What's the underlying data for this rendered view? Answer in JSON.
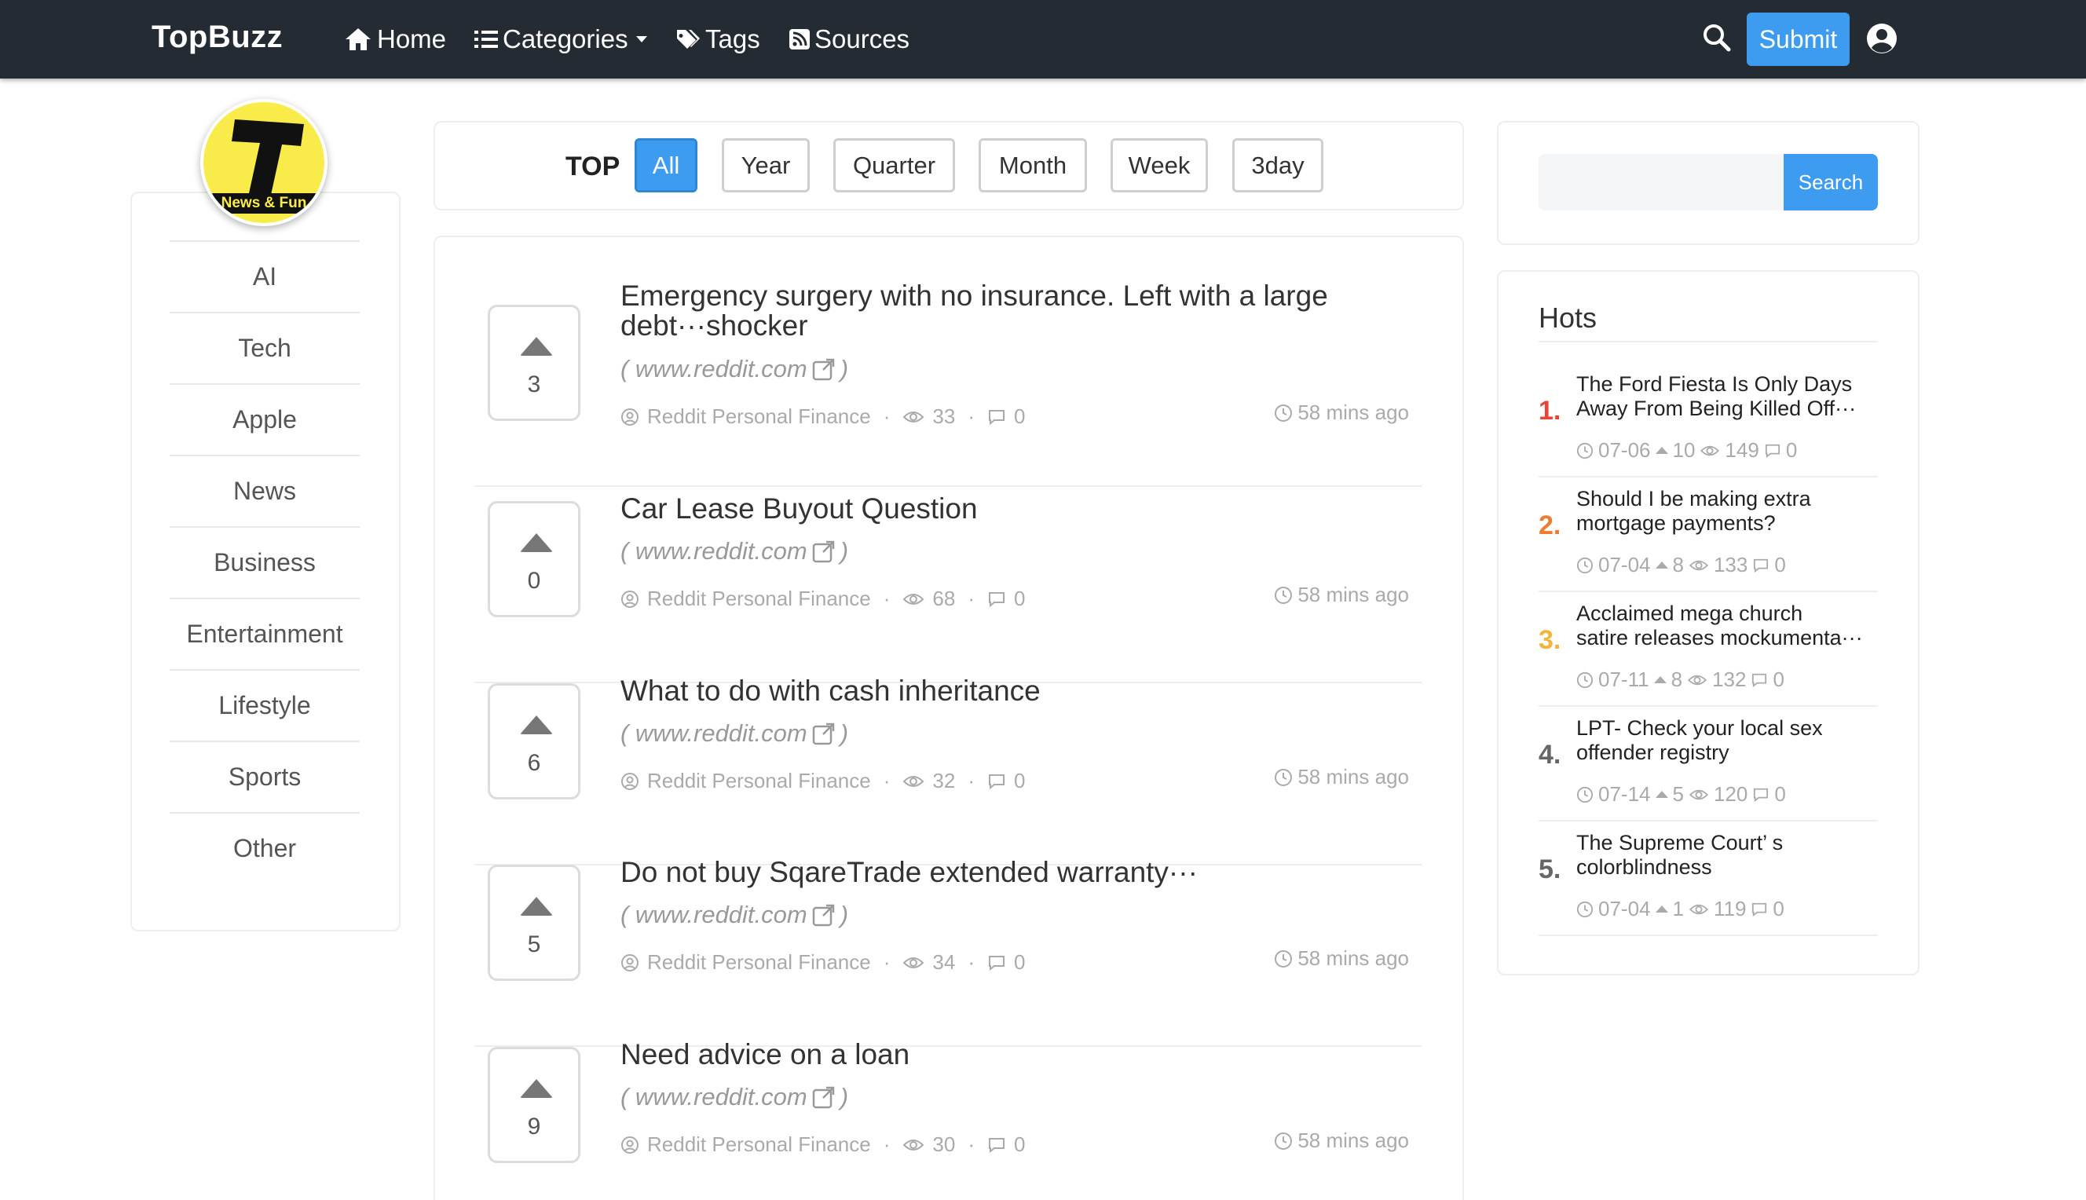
{
  "brand": "TopBuzz",
  "nav": {
    "home": "Home",
    "categories": "Categories",
    "tags": "Tags",
    "sources": "Sources",
    "submit": "Submit"
  },
  "logo": {
    "band_text": "News & Fun"
  },
  "categories": [
    "AI",
    "Tech",
    "Apple",
    "News",
    "Business",
    "Entertainment",
    "Lifestyle",
    "Sports",
    "Other"
  ],
  "filter": {
    "label": "TOP",
    "options": [
      "All",
      "Year",
      "Quarter",
      "Month",
      "Week",
      "3day"
    ],
    "active": "All"
  },
  "posts": [
    {
      "votes": "3",
      "title_l1": "Emergency surgery with no insurance. Left with a large",
      "title_l2": "debt···shocker",
      "source": "( www.reddit.com",
      "source_close": ")",
      "author": "Reddit Personal Finance",
      "views": "33",
      "comments": "0",
      "time": "58 mins ago"
    },
    {
      "votes": "0",
      "title_l1": "Car Lease Buyout Question",
      "title_l2": "",
      "source": "( www.reddit.com",
      "source_close": ")",
      "author": "Reddit Personal Finance",
      "views": "68",
      "comments": "0",
      "time": "58 mins ago"
    },
    {
      "votes": "6",
      "title_l1": "What to do with cash inheritance",
      "title_l2": "",
      "source": "( www.reddit.com",
      "source_close": ")",
      "author": "Reddit Personal Finance",
      "views": "32",
      "comments": "0",
      "time": "58 mins ago"
    },
    {
      "votes": "5",
      "title_l1": "Do not buy SqareTrade extended warranty···",
      "title_l2": "",
      "source": "( www.reddit.com",
      "source_close": ")",
      "author": "Reddit Personal Finance",
      "views": "34",
      "comments": "0",
      "time": "58 mins ago"
    },
    {
      "votes": "9",
      "title_l1": "Need advice on a loan",
      "title_l2": "",
      "source": "( www.reddit.com",
      "source_close": ")",
      "author": "Reddit Personal Finance",
      "views": "30",
      "comments": "0",
      "time": "58 mins ago"
    }
  ],
  "search": {
    "placeholder": "",
    "button": "Search"
  },
  "hots": {
    "title": "Hots",
    "items": [
      {
        "rank": "1.",
        "rank_color": "#e8443a",
        "title_l1": "The Ford Fiesta Is Only Days",
        "title_l2": "Away From Being Killed Off···",
        "date": "07-06",
        "votes": "10",
        "views": "149",
        "comments": "0"
      },
      {
        "rank": "2.",
        "rank_color": "#ef7b2d",
        "title_l1": "Should I be making extra",
        "title_l2": "mortgage payments?",
        "date": "07-04",
        "votes": "8",
        "views": "133",
        "comments": "0"
      },
      {
        "rank": "3.",
        "rank_color": "#f2b43d",
        "title_l1": "Acclaimed mega church",
        "title_l2": "satire releases mockumenta···",
        "date": "07-11",
        "votes": "8",
        "views": "132",
        "comments": "0"
      },
      {
        "rank": "4.",
        "rank_color": "#666666",
        "title_l1": "LPT- Check your local sex",
        "title_l2": "offender registry",
        "date": "07-14",
        "votes": "5",
        "views": "120",
        "comments": "0"
      },
      {
        "rank": "5.",
        "rank_color": "#666666",
        "title_l1": "The Supreme Court’ s",
        "title_l2": "colorblindness",
        "date": "07-04",
        "votes": "1",
        "views": "119",
        "comments": "0"
      }
    ]
  },
  "colors": {
    "navbar": "#252b33",
    "accent": "#3d9cf0"
  }
}
